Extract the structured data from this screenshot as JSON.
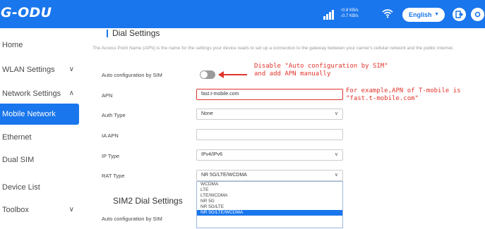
{
  "header": {
    "logo": "G-ODU",
    "speed_up": "↑0.8 KB/s",
    "speed_down": "↓0.7 KB/s",
    "language": "English",
    "icons": [
      "signal-icon",
      "wifi-icon",
      "logout-icon",
      "settings-icon"
    ]
  },
  "sidebar": {
    "items": [
      {
        "label": "Home"
      },
      {
        "label": "WLAN Settings",
        "chevron": "∨"
      },
      {
        "label": "Network Settings",
        "chevron": "∧"
      },
      {
        "label": "Mobile Network"
      },
      {
        "label": "Ethernet"
      },
      {
        "label": "Dual SIM"
      },
      {
        "label": "Device List"
      },
      {
        "label": "Toolbox",
        "chevron": "∨"
      }
    ]
  },
  "main": {
    "section1_title": "Dial Settings",
    "description": "The Access Point Name (APN) is the name for the settings your device reads to set up a connection to the gateway between your carrier's cellular network and the public Internet.",
    "rows": {
      "auto_config_label": "Auto configuration by SIM",
      "apn_label": "APN",
      "apn_value": "fast.t-mobile.com",
      "auth_label": "Auth Type",
      "auth_value": "None",
      "ia_apn_label": "IA APN",
      "ia_apn_value": "",
      "ip_type_label": "IP Type",
      "ip_type_value": "IPv4/IPv6",
      "rat_type_label": "RAT Type",
      "rat_type_value": "NR 5G/LTE/WCDMA"
    },
    "rat_options": [
      "WCDMA",
      "LTE",
      "LTE/WCDMA",
      "NR 5G",
      "NR 5G/LTE",
      "NR 5G/LTE/WCDMA"
    ],
    "rat_selected_index": 5,
    "section2_title": "SIM2 Dial Settings",
    "sim2_auto_config_label": "Auto configuration by SIM",
    "auto_config_enabled": false
  },
  "annotations": {
    "toggle_note_line1": "Disable \"Auto configuration by SIM\"",
    "toggle_note_line2": "and add APN manually",
    "apn_note_line1": "For example,APN of T-mobile is",
    "apn_note_line2": "\"fast.t-mobile.com\""
  },
  "colors": {
    "primary": "#1976ec",
    "annotation": "#e0342b"
  }
}
